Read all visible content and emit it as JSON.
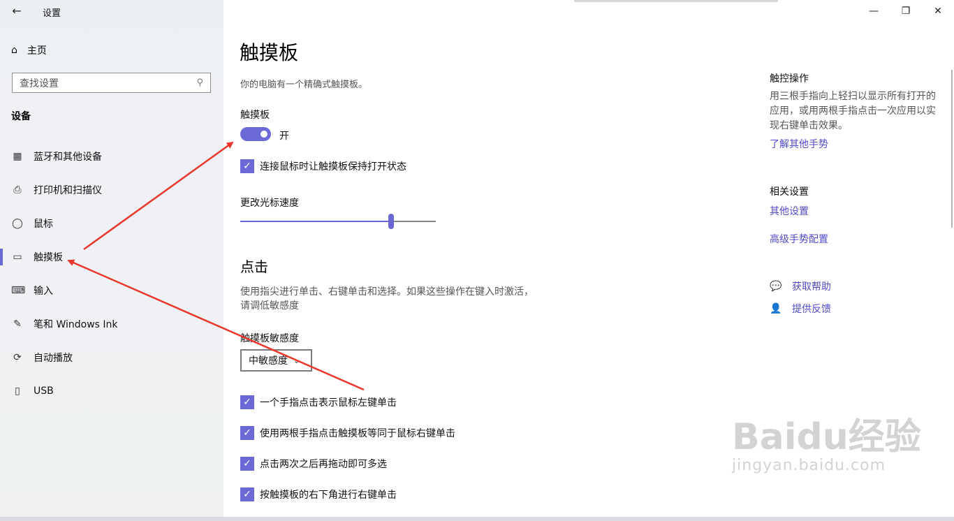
{
  "window": {
    "title": "设置",
    "back_icon": "←",
    "minimize_icon": "—",
    "restore_icon": "❐",
    "close_icon": "✕"
  },
  "sidebar": {
    "home_label": "主页",
    "home_icon": "⌂",
    "search_placeholder": "查找设置",
    "search_icon": "⚲",
    "group_title": "设备",
    "items": [
      {
        "label": "蓝牙和其他设备",
        "icon": "▦"
      },
      {
        "label": "打印机和扫描仪",
        "icon": "⎙"
      },
      {
        "label": "鼠标",
        "icon": "◯"
      },
      {
        "label": "触摸板",
        "icon": "▭",
        "active": true
      },
      {
        "label": "输入",
        "icon": "⌨"
      },
      {
        "label": "笔和 Windows Ink",
        "icon": "✎"
      },
      {
        "label": "自动播放",
        "icon": "⟳"
      },
      {
        "label": "USB",
        "icon": "▯"
      }
    ]
  },
  "main": {
    "title": "触摸板",
    "description": "你的电脑有一个精确式触摸板。",
    "touchpad_label": "触摸板",
    "toggle_state": "开",
    "keep_on_checkbox": "连接鼠标时让触摸板保持打开状态",
    "cursor_speed_label": "更改光标速度",
    "cursor_speed_value": 0.77,
    "taps_title": "点击",
    "taps_description": "使用指尖进行单击、右键单击和选择。如果这些操作在键入时激活，请调低敏感度",
    "sensitivity_label": "触摸板敏感度",
    "sensitivity_value": "中敏感度",
    "check_icon": "✓",
    "tap_options": [
      "一个手指点击表示鼠标左键单击",
      "使用两根手指点击触摸板等同于鼠标右键单击",
      "点击两次之后再拖动即可多选",
      "按触摸板的右下角进行右键单击"
    ]
  },
  "right": {
    "gestures_title": "触控操作",
    "gestures_text": "用三根手指向上轻扫以显示所有打开的应用，或用两根手指点击一次应用以实现右键单击效果。",
    "gestures_link": "了解其他手势",
    "related_title": "相关设置",
    "related_links": [
      "其他设置",
      "高级手势配置"
    ],
    "help_label": "获取帮助",
    "feedback_label": "提供反馈",
    "help_icon": "💬",
    "feedback_icon": "👤"
  },
  "watermark": {
    "brand": "Baidu经验",
    "url": "jingyan.baidu.com"
  },
  "colors": {
    "accent": "#6b69d6",
    "link": "#4f4ac9",
    "arrow": "#e8372c"
  }
}
